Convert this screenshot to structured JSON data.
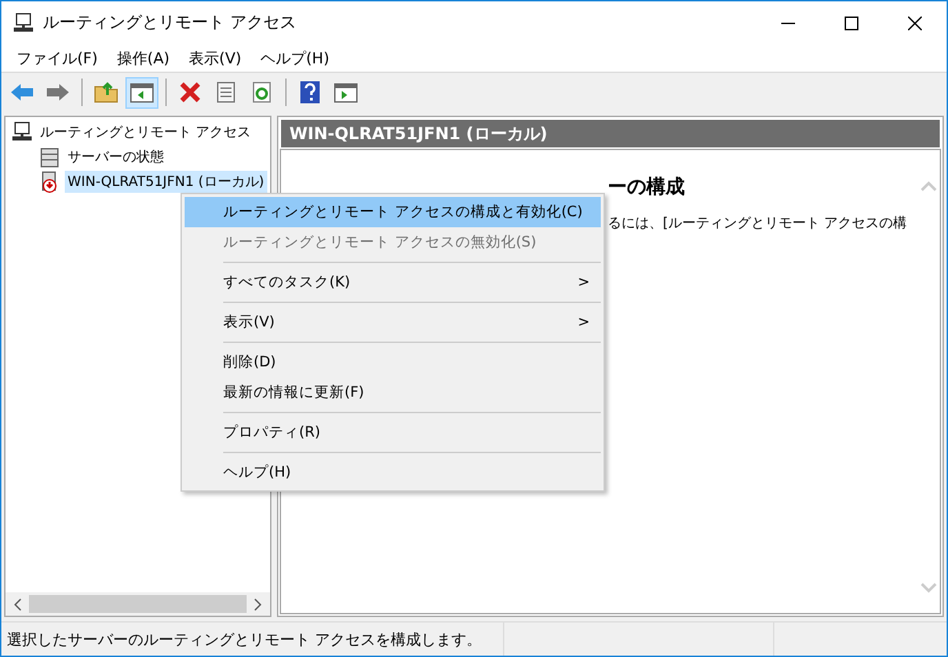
{
  "window": {
    "title": "ルーティングとリモート アクセス"
  },
  "menu_bar": [
    "ファイル(F)",
    "操作(A)",
    "表示(V)",
    "ヘルプ(H)"
  ],
  "toolbar": [
    {
      "kind": "back",
      "pressed": false
    },
    {
      "kind": "forward",
      "pressed": false
    },
    {
      "kind": "sep"
    },
    {
      "kind": "up",
      "pressed": false
    },
    {
      "kind": "pane",
      "pressed": true
    },
    {
      "kind": "sep"
    },
    {
      "kind": "delete",
      "pressed": false
    },
    {
      "kind": "list",
      "pressed": false
    },
    {
      "kind": "refresh",
      "pressed": false
    },
    {
      "kind": "sep"
    },
    {
      "kind": "help",
      "pressed": false
    },
    {
      "kind": "panel",
      "pressed": false
    }
  ],
  "tree": {
    "label": "ルーティングとリモート アクセス",
    "children": [
      {
        "label": "サーバーの状態",
        "kind": "servers",
        "selected": false
      },
      {
        "label": "WIN-QLRAT51JFN1 (ローカル)",
        "kind": "server",
        "selected": true
      }
    ]
  },
  "content": {
    "header": "WIN-QLRAT51JFN1 (ローカル)",
    "heading": "ーの構成",
    "body": "るには、[ルーティングとリモート アクセスの構"
  },
  "context_menu": [
    {
      "kind": "item",
      "label": "ルーティングとリモート アクセスの構成と有効化(C)",
      "selected": true,
      "disabled": false
    },
    {
      "kind": "item",
      "label": "ルーティングとリモート アクセスの無効化(S)",
      "selected": false,
      "disabled": true
    },
    {
      "kind": "separator"
    },
    {
      "kind": "item",
      "label": "すべてのタスク(K)",
      "selected": false,
      "disabled": false,
      "submenu": ">"
    },
    {
      "kind": "separator"
    },
    {
      "kind": "item",
      "label": "表示(V)",
      "selected": false,
      "disabled": false,
      "submenu": ">"
    },
    {
      "kind": "separator"
    },
    {
      "kind": "item",
      "label": "削除(D)",
      "selected": false,
      "disabled": false
    },
    {
      "kind": "item",
      "label": "最新の情報に更新(F)",
      "selected": false,
      "disabled": false
    },
    {
      "kind": "separator"
    },
    {
      "kind": "item",
      "label": "プロパティ(R)",
      "selected": false,
      "disabled": false
    },
    {
      "kind": "separator"
    },
    {
      "kind": "item",
      "label": "ヘルプ(H)",
      "selected": false,
      "disabled": false
    }
  ],
  "status_bar": [
    "選択したサーバーのルーティングとリモート アクセスを構成します。"
  ]
}
